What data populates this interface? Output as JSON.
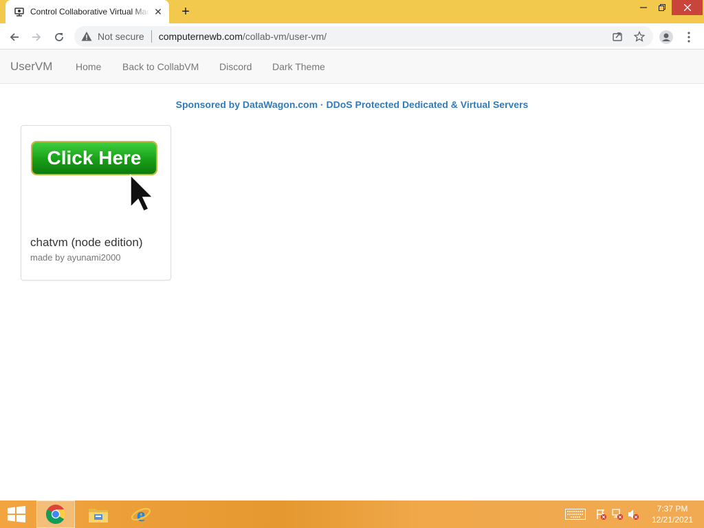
{
  "browser": {
    "tab_title": "Control Collaborative Virtual Machine",
    "not_secure_label": "Not secure",
    "url_host": "computernewb.com",
    "url_path": "/collab-vm/user-vm/"
  },
  "navbar": {
    "brand": "UserVM",
    "links": [
      "Home",
      "Back to CollabVM",
      "Discord",
      "Dark Theme"
    ]
  },
  "page": {
    "sponsor_text": "Sponsored by DataWagon.com · DDoS Protected Dedicated & Virtual Servers",
    "cards": [
      {
        "image_text": "Click Here",
        "title": "chatvm (node edition)",
        "subtitle": "made by ayunami2000"
      }
    ]
  },
  "taskbar": {
    "time": "7:37 PM",
    "date": "12/21/2021",
    "apps": [
      "chrome-icon",
      "file-explorer-icon",
      "internet-explorer-icon"
    ]
  },
  "colors": {
    "accent": "#337ab7",
    "titlebar": "#f2c94c",
    "taskbar": "#e5982f",
    "button_green": "#1aa31a"
  }
}
